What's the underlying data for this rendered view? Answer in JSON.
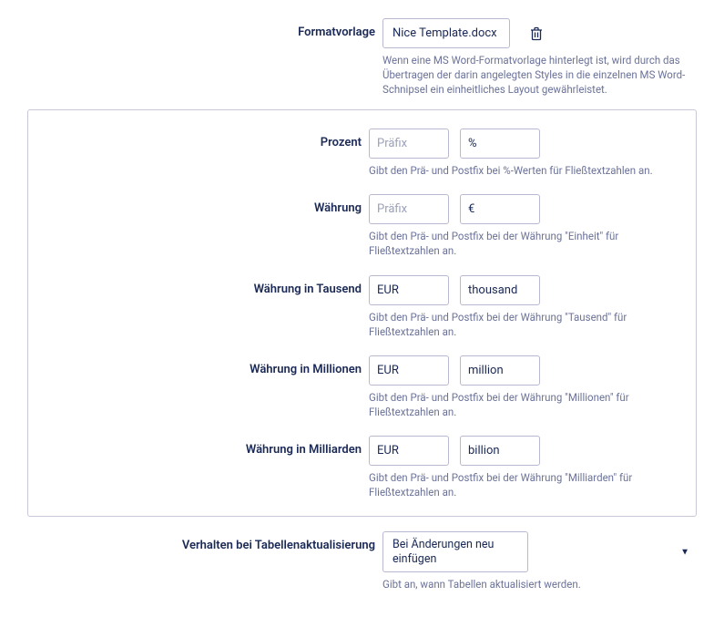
{
  "template": {
    "label": "Formatvorlage",
    "filename": "Nice Template.docx",
    "help": "Wenn eine MS Word-Formatvorlage hinterlegt ist, wird durch das Übertragen der darin angelegten Styles in die einzelnen MS Word-Schnipsel ein einheitliches Layout gewährleistet."
  },
  "percent": {
    "label": "Prozent",
    "prefix_placeholder": "Präfix",
    "prefix": "",
    "postfix": "%",
    "help": "Gibt den Prä- und Postfix bei %-Werten für Fließtextzahlen an."
  },
  "currency": {
    "label": "Währung",
    "prefix_placeholder": "Präfix",
    "prefix": "",
    "postfix": "€",
    "help": "Gibt den Prä- und Postfix bei der Währung \"Einheit\" für Fließtextzahlen an."
  },
  "currency_thousand": {
    "label": "Währung in Tausend",
    "prefix": "EUR",
    "postfix": "thousand",
    "help": "Gibt den Prä- und Postfix bei der Währung \"Tausend\" für Fließtextzahlen an."
  },
  "currency_million": {
    "label": "Währung in Millionen",
    "prefix": "EUR",
    "postfix": "million",
    "help": "Gibt den Prä- und Postfix bei der Währung \"Millionen\" für Fließtextzahlen an."
  },
  "currency_billion": {
    "label": "Währung in Milliarden",
    "prefix": "EUR",
    "postfix": "billion",
    "help": "Gibt den Prä- und Postfix bei der Währung \"Milliarden\" für Fließtextzahlen an."
  },
  "table_update": {
    "label": "Verhalten bei Tabellenaktualisierung",
    "selected": "Bei Änderungen neu einfügen",
    "help": "Gibt an, wann Tabellen aktualisiert werden."
  }
}
